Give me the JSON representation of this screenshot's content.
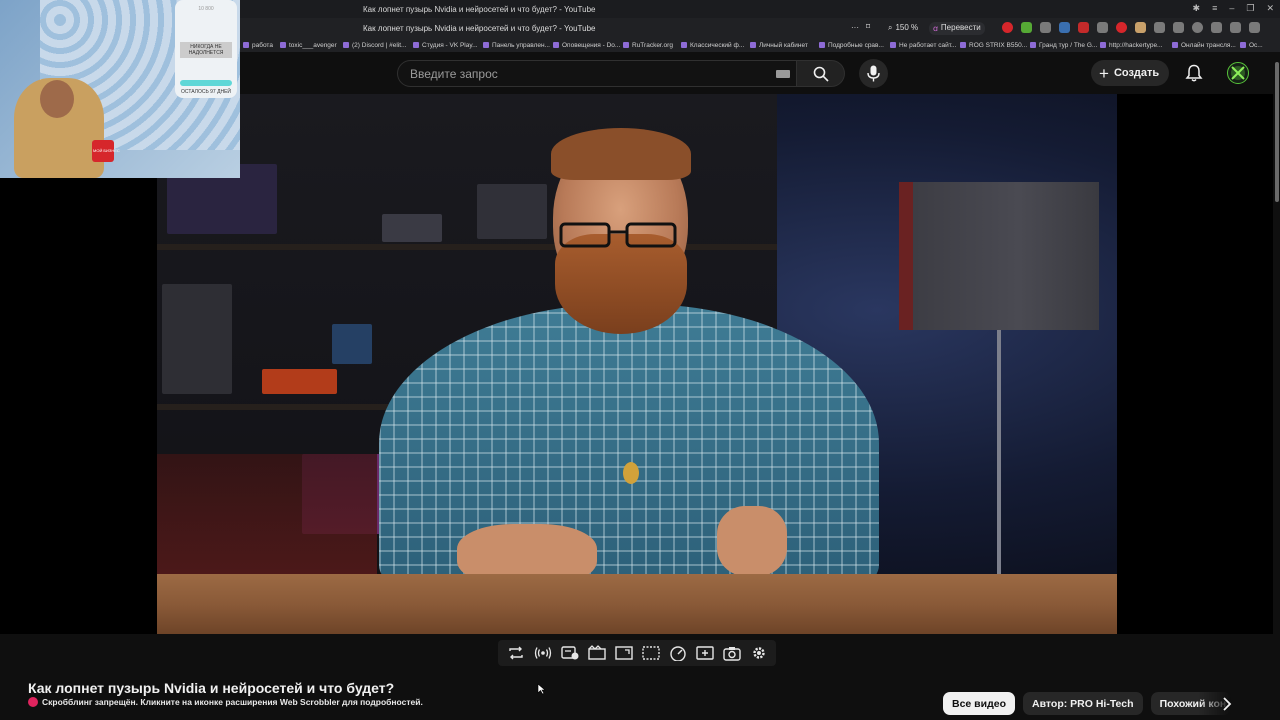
{
  "browser": {
    "window_title": "Как лопнет пузырь Nvidia и нейросетей и что будет? - YouTube",
    "tab_title": "Как лопнет пузырь Nvidia и нейросетей и что будет? - YouTube",
    "zoom": "150 %",
    "translate_label": "Перевести",
    "bookmarks": [
      "работа",
      "toxic___avenger",
      "(2) Discord | #elit...",
      "Студия - VK Play...",
      "Панель управлен...",
      "Оповещения - Do...",
      "RuTracker.org",
      "Классический ф...",
      "Личный кабинет",
      "Подробные срав...",
      "Не работает сайт...",
      "ROG STRIX B550...",
      "Гранд тур / The G...",
      "http://hackertype...",
      "Онлайн трансля...",
      "Ос..."
    ]
  },
  "youtube": {
    "search": {
      "placeholder": "Введите запрос"
    },
    "create_label": "Создать"
  },
  "webcam": {
    "phone_time": "10 800",
    "phone_text": "НИКОГДА НЕ НАДОЛНЕТСЯ",
    "phone_footer": "ОСТАЛОСЬ 97 ДНЕЙ",
    "mug_text": "МОЙ БИЗНЕС"
  },
  "video": {
    "title": "Как лопнет пузырь Nvidia и нейросетей и что будет?",
    "scrobble_notice": "Скробблинг запрещён. Кликните на иконке расширения Web Scrobbler для подробностей."
  },
  "chips": [
    {
      "label": "Все видео",
      "active": true
    },
    {
      "label": "Автор: PRO Hi-Tech",
      "active": false
    },
    {
      "label": "Похожий контент",
      "active": false
    }
  ],
  "colors": {
    "background": "#0f0f0f",
    "chip_active": "#f1f1f1",
    "accent_green": "#57c43a",
    "scrobble_red": "#e0245e"
  }
}
